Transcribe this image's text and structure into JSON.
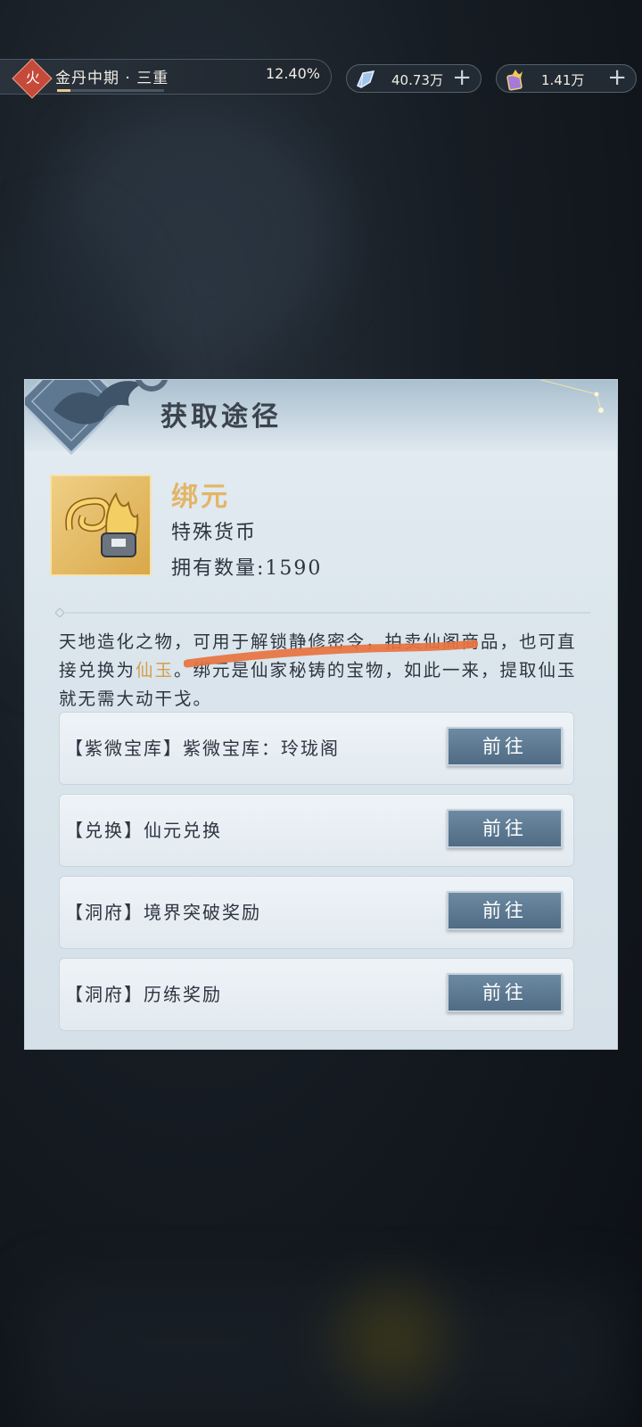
{
  "top_bar": {
    "element_badge": "火",
    "realm": "金丹中期 · 三重",
    "progress_pct": "12.40%",
    "progress_fraction": 0.124,
    "currency_1": {
      "icon": "crystal-icon",
      "value": "40.73万"
    },
    "currency_2": {
      "icon": "purple-token-icon",
      "value": "1.41万"
    },
    "plus": "+"
  },
  "dialog": {
    "title": "获取途径",
    "item": {
      "icon": "gold-token-icon",
      "name": "绑元",
      "type": "特殊货币",
      "count_label": "拥有数量:",
      "count_value": "1590"
    },
    "description": {
      "part1": "天地造化之物，可用于解锁静修密令，拍卖仙阁商品，也可直接兑换为",
      "highlight": "仙玉",
      "part2": "。绑元是仙家秘铸的宝物，如此一来，提取仙玉就无需大动干戈。"
    },
    "routes": [
      {
        "label": "【紫微宝库】紫微宝库：玲珑阁",
        "button": "前往"
      },
      {
        "label": "【兑换】仙元兑换",
        "button": "前往"
      },
      {
        "label": "【洞府】境界突破奖励",
        "button": "前往"
      },
      {
        "label": "【洞府】历练奖励",
        "button": "前往"
      }
    ]
  },
  "colors": {
    "accent_gold": "#e3b567",
    "button_blue": "#5a7690",
    "annotation_orange": "#e8733f"
  }
}
